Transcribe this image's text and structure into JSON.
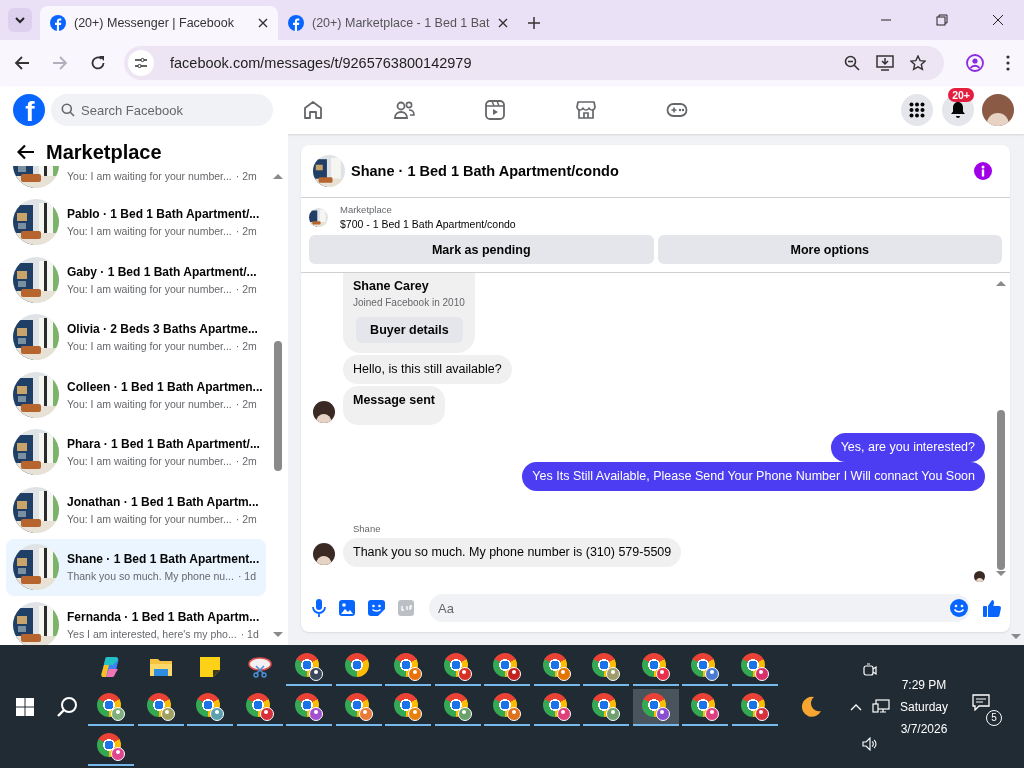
{
  "browser": {
    "tabs": [
      {
        "title": "(20+) Messenger | Facebook",
        "selected": true
      },
      {
        "title": "(20+) Marketplace - 1 Bed 1 Bat",
        "selected": false
      }
    ],
    "nav": [
      {
        "kind": "back",
        "disabled": false
      },
      {
        "kind": "forward",
        "disabled": true
      },
      {
        "kind": "reload",
        "disabled": false
      }
    ],
    "url": "facebook.com/messages/t/9265763800142979"
  },
  "facebook": {
    "logo": "f",
    "search": {
      "placeholder": "Search Facebook"
    },
    "nav": [
      {
        "kind": "home"
      },
      {
        "kind": "friends"
      },
      {
        "kind": "video"
      },
      {
        "kind": "marketplace"
      },
      {
        "kind": "gaming"
      }
    ],
    "notification_badge": "20+"
  },
  "sidebar": {
    "title": "Marketplace",
    "conversations": [
      {
        "preview": "You: I am waiting for your number...",
        "time": "· 2m",
        "selected": false
      },
      {
        "name": "Pablo · 1 Bed 1 Bath Apartment/...",
        "preview": "You: I am waiting for your number...",
        "time": "· 2m",
        "selected": false
      },
      {
        "name": "Gaby · 1 Bed 1 Bath Apartment/...",
        "preview": "You: I am waiting for your number...",
        "time": "· 2m",
        "selected": false
      },
      {
        "name": "Olivia · 2 Beds 3 Baths Apartme...",
        "preview": "You: I am waiting for your number...",
        "time": "· 2m",
        "selected": false
      },
      {
        "name": "Colleen · 1 Bed 1 Bath Apartmen...",
        "preview": "You: I am waiting for your number...",
        "time": "· 2m",
        "selected": false
      },
      {
        "name": "Phara · 1 Bed 1 Bath Apartment/...",
        "preview": "You: I am waiting for your number...",
        "time": "· 2m",
        "selected": false
      },
      {
        "name": "Jonathan · 1 Bed 1 Bath Apartm...",
        "preview": "You: I am waiting for your number...",
        "time": "· 2m",
        "selected": false
      },
      {
        "name": "Shane · 1 Bed 1 Bath Apartment...",
        "preview": "Thank you so much. My phone nu...",
        "time": "· 1d",
        "selected": true
      },
      {
        "name": "Fernanda · 1 Bed 1 Bath Apartm...",
        "preview": "Yes I am interested, here's my pho...",
        "time": "· 1d",
        "selected": false
      }
    ]
  },
  "chat": {
    "title": "Shane · 1 Bed 1 Bath Apartment/condo",
    "listing": {
      "source": "Marketplace",
      "summary": "$700 - 1 Bed 1 Bath Apartment/condo"
    },
    "actions": [
      "Mark as pending",
      "More options"
    ],
    "messages": [
      {
        "kind": "profile_card",
        "name": "Shane Carey",
        "subtitle": "Joined Facebook in 2010",
        "button": "Buyer details"
      },
      {
        "kind": "in",
        "text": "Hello, is this still available?",
        "avatar": false,
        "bold": false
      },
      {
        "kind": "in",
        "text": "Message sent",
        "avatar": true,
        "bold": true
      },
      {
        "kind": "out",
        "text": "Yes, are you interested?"
      },
      {
        "kind": "out",
        "text": "Yes Its Still Available, Please Send Your Phone Number I Will connact You Soon"
      },
      {
        "kind": "in",
        "sender": "Shane",
        "text": "Thank you so much. My phone number is (310) 579-5509",
        "avatar": true,
        "bold": false
      }
    ],
    "composer": {
      "placeholder": "Aa"
    }
  },
  "taskbar": {
    "apps": [
      {
        "kind": "copilot",
        "running": false,
        "active": false
      },
      {
        "kind": "file-explorer",
        "running": false,
        "active": false
      },
      {
        "kind": "sticky-notes",
        "running": false,
        "active": false
      },
      {
        "kind": "snipping-tool",
        "running": false,
        "active": false
      },
      {
        "kind": "chrome-profile",
        "color": "#3a4a5a",
        "running": true,
        "active": false
      },
      {
        "kind": "chrome",
        "running": true,
        "active": false
      },
      {
        "kind": "chrome-profile",
        "color": "#e8710a",
        "running": true,
        "active": false
      },
      {
        "kind": "chrome-profile",
        "color": "#d93025",
        "running": true,
        "active": false
      },
      {
        "kind": "chrome-profile",
        "color": "#c5221f",
        "running": true,
        "active": false
      },
      {
        "kind": "chrome-profile",
        "color": "#e37400",
        "running": true,
        "active": false
      },
      {
        "kind": "chrome-profile",
        "color": "#9e9d6a",
        "running": true,
        "active": false
      },
      {
        "kind": "chrome-profile",
        "color": "#e8304a",
        "running": true,
        "active": false
      },
      {
        "kind": "chrome-profile",
        "color": "#4a7bd0",
        "running": true,
        "active": false
      },
      {
        "kind": "chrome-profile",
        "color": "#d93069",
        "running": true,
        "active": false
      },
      {
        "kind": "chrome-profile",
        "color": "#7fae7f",
        "running": true,
        "active": false
      },
      {
        "kind": "chrome-profile",
        "color": "#a0a060",
        "running": true,
        "active": false
      },
      {
        "kind": "chrome-profile",
        "color": "#5aa0b0",
        "running": true,
        "active": false
      },
      {
        "kind": "chrome-profile",
        "color": "#d8303a",
        "running": true,
        "active": false
      },
      {
        "kind": "chrome-profile",
        "color": "#a050d0",
        "running": true,
        "active": false
      },
      {
        "kind": "chrome-profile",
        "color": "#e87a3a",
        "running": true,
        "active": false
      },
      {
        "kind": "chrome-profile",
        "color": "#e88010",
        "running": true,
        "active": false
      },
      {
        "kind": "chrome-profile",
        "color": "#6aa06a",
        "running": true,
        "active": false
      },
      {
        "kind": "chrome-profile",
        "color": "#e0701a",
        "running": true,
        "active": false
      },
      {
        "kind": "chrome-profile",
        "color": "#e0407a",
        "running": true,
        "active": false
      },
      {
        "kind": "chrome-profile",
        "color": "#70a070",
        "running": true,
        "active": false
      },
      {
        "kind": "chrome-profile",
        "color": "#8a4fd0",
        "running": true,
        "active": true
      },
      {
        "kind": "chrome-profile",
        "color": "#e04080",
        "running": true,
        "active": false
      },
      {
        "kind": "chrome-profile",
        "color": "#d93040",
        "running": true,
        "active": false
      },
      {
        "kind": "chrome-profile",
        "color": "#e04590",
        "running": true,
        "active": false
      }
    ],
    "clock": {
      "time": "7:29 PM",
      "day": "Saturday",
      "date": "3/7/2026"
    },
    "notifications": "5"
  }
}
